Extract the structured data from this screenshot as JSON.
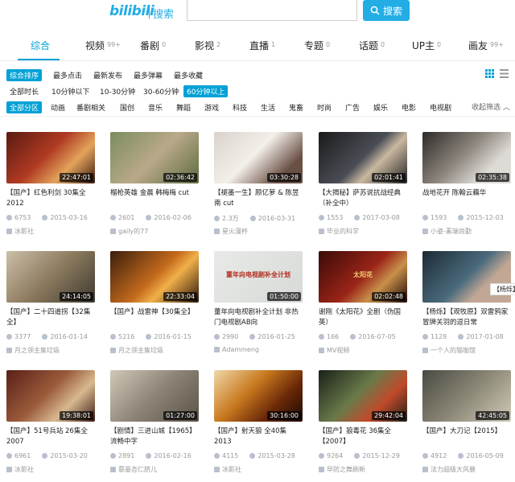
{
  "header": {
    "logo": "bilibili",
    "logo_sub": "搜索",
    "search_value": "",
    "search_button": "搜索"
  },
  "tabs": [
    {
      "label": "综合",
      "count": ""
    },
    {
      "label": "视频",
      "count": "99+"
    },
    {
      "label": "番剧",
      "count": "0"
    },
    {
      "label": "影视",
      "count": "2"
    },
    {
      "label": "直播",
      "count": "1"
    },
    {
      "label": "专题",
      "count": "0"
    },
    {
      "label": "话题",
      "count": "0"
    },
    {
      "label": "UP主",
      "count": "0"
    },
    {
      "label": "画友",
      "count": "99+"
    }
  ],
  "filters": {
    "sort": [
      "综合排序",
      "最多点击",
      "最新发布",
      "最多弹幕",
      "最多收藏"
    ],
    "duration": [
      "全部时长",
      "10分钟以下",
      "10-30分钟",
      "30-60分钟",
      "60分钟以上"
    ],
    "zone": [
      "全部分区",
      "动画",
      "番剧相关",
      "国创",
      "音乐",
      "舞蹈",
      "游戏",
      "科技",
      "生活",
      "鬼畜",
      "时尚",
      "广告",
      "娱乐",
      "电影",
      "电视剧"
    ],
    "collapse": "收起筛选"
  },
  "videos": [
    {
      "title": "【国产】红色利剑 30集全 2012",
      "duration": "22:47:01",
      "views": "6753",
      "date": "2015-03-16",
      "up": "冰影社"
    },
    {
      "title": "榴枪英雄 金晨 韩梅梅 cut",
      "duration": "02:36:42",
      "views": "2601",
      "date": "2016-02-06",
      "up": "gaily的77"
    },
    {
      "title": "【褪墨一生】顾亿萝 & 陈昱南 cut",
      "duration": "03:30:28",
      "views": "2.3万",
      "date": "2016-03-31",
      "up": "星火漫杯"
    },
    {
      "title": "【大揭秘】萨苏说抗战经典（补全中）",
      "duration": "02:01:41",
      "views": "1553",
      "date": "2017-03-08",
      "up": "毕业的科学"
    },
    {
      "title": "战地花开 陈翰云藕华",
      "duration": "02:35:38",
      "views": "1593",
      "date": "2015-12-03",
      "up": "小姿-素端尚勤"
    },
    {
      "title": "【国产】二十四道拐【32集全】",
      "duration": "24:14:05",
      "views": "3377",
      "date": "2016-01-14",
      "up": "月之领主集垃圾"
    },
    {
      "title": "【国产】战雷神【30集全】",
      "duration": "22:33:04",
      "views": "5216",
      "date": "2016-01-15",
      "up": "月之领主集垃圾"
    },
    {
      "title": "董年向电视剧补全计划 非热门电视剧AB向",
      "duration": "01:50:00",
      "views": "2990",
      "date": "2016-01-25",
      "up": "Adammeng",
      "thumb_text": "董年向电视剧补全计划"
    },
    {
      "title": "谢刚《太阳花》全剧（伪国英）",
      "duration": "02:02:48",
      "views": "166",
      "date": "2016-07-05",
      "up": "MV视频",
      "thumb_text": "太阳花"
    },
    {
      "title": "【杨烁】【观牧原】双雷鸦家 冒牌关羽的逗日常",
      "duration": "",
      "views": "1128",
      "date": "2017-01-08",
      "up": "一个人的猫咖馆",
      "badge": "【杨烁】"
    },
    {
      "title": "【国产】51号兵站 26集全 2007",
      "duration": "19:38:01",
      "views": "6961",
      "date": "2015-03-20",
      "up": "冰影社"
    },
    {
      "title": "【剧情】三进山城【1965】流畅中字",
      "duration": "01:27:00",
      "views": "2891",
      "date": "2016-02-16",
      "up": "慕墨杏仁脐儿"
    },
    {
      "title": "【国产】射天狼 全40集 2013",
      "duration": "30:16:00",
      "views": "4115",
      "date": "2015-03-28",
      "up": "冰影社"
    },
    {
      "title": "【国产】狼毒花 36集全【2007】",
      "duration": "29:42:04",
      "views": "9264",
      "date": "2015-12-29",
      "up": "早防之舞刷新"
    },
    {
      "title": "【国产】大刀记【2015】",
      "duration": "42:45:05",
      "views": "4912",
      "date": "2016-05-09",
      "up": "法力超级大风暴"
    }
  ],
  "colors": {
    "accent": "#00a1d6",
    "brand": "#23ade5"
  }
}
